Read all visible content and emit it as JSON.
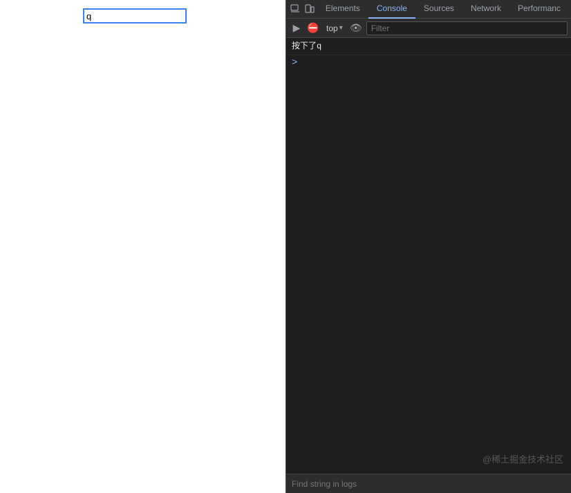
{
  "webpage": {
    "input_value": "q",
    "input_placeholder": ""
  },
  "devtools": {
    "tabs": [
      {
        "label": "Elements",
        "active": false
      },
      {
        "label": "Console",
        "active": true
      },
      {
        "label": "Sources",
        "active": false
      },
      {
        "label": "Network",
        "active": false
      },
      {
        "label": "Performanc",
        "active": false
      }
    ],
    "toolbar": {
      "top_label": "top",
      "filter_placeholder": "Filter"
    },
    "console": {
      "message": "按下了q",
      "prompt_symbol": ">",
      "watermark": "@稀土掘金技术社区"
    },
    "find_bar": {
      "placeholder": "Find string in logs"
    }
  }
}
